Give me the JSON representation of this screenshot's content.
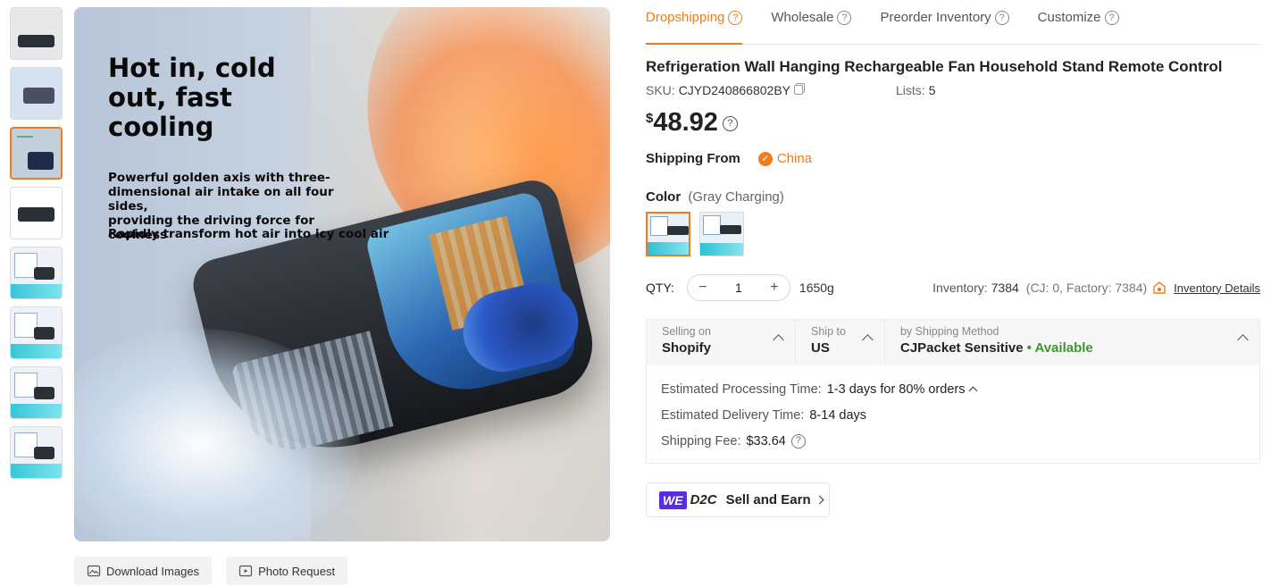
{
  "gallery": {
    "thumbnail_count": 8,
    "active_index": 2,
    "hero": {
      "headline": "Hot in, cold\nout, fast\ncooling",
      "description": "Powerful golden axis with three-\ndimensional air intake on all four sides,\nproviding the driving force for coolness",
      "tagline": "Rapidly transform hot air into icy cool air"
    },
    "actions": {
      "download_label": "Download Images",
      "photo_request_label": "Photo Request"
    }
  },
  "tabs": [
    {
      "label": "Dropshipping",
      "active": true
    },
    {
      "label": "Wholesale",
      "active": false
    },
    {
      "label": "Preorder Inventory",
      "active": false
    },
    {
      "label": "Customize",
      "active": false
    }
  ],
  "product": {
    "title": "Refrigeration Wall Hanging Rechargeable Fan Household Stand Remote Control",
    "sku_label": "SKU:",
    "sku": "CJYD240866802BY",
    "lists_label": "Lists:",
    "lists": "5",
    "currency": "$",
    "price": "48.92",
    "shipping_from_label": "Shipping From",
    "shipping_from": "China",
    "color_label": "Color",
    "color_selected": "(Gray Charging)",
    "qty_label": "QTY:",
    "qty": "1",
    "weight": "1650g",
    "inventory_label": "Inventory:",
    "inventory": "7384",
    "inventory_detail": "(CJ: 0, Factory: 7384)",
    "inventory_link": "Inventory Details"
  },
  "shipping": {
    "selling_on_label": "Selling on",
    "selling_on": "Shopify",
    "ship_to_label": "Ship to",
    "ship_to": "US",
    "method_label": "by Shipping Method",
    "method": "CJPacket Sensitive",
    "availability": "• Available",
    "processing_label": "Estimated Processing Time:",
    "processing": "1-3 days for 80% orders",
    "delivery_label": "Estimated Delivery Time:",
    "delivery": "8-14 days",
    "fee_label": "Shipping Fee:",
    "fee": "$33.64"
  },
  "promo": {
    "logo_we": "WE",
    "logo_d2c": "D2C",
    "label": "Sell and Earn"
  },
  "colors": {
    "accent": "#f07c1b",
    "available": "#3a9a2e",
    "we_brand": "#5b2be0"
  },
  "icons": [
    "question-icon",
    "copy-icon",
    "check-badge-icon",
    "warehouse-icon",
    "chevron-up-icon",
    "chevron-right-icon",
    "download-image-icon",
    "photo-request-icon"
  ]
}
